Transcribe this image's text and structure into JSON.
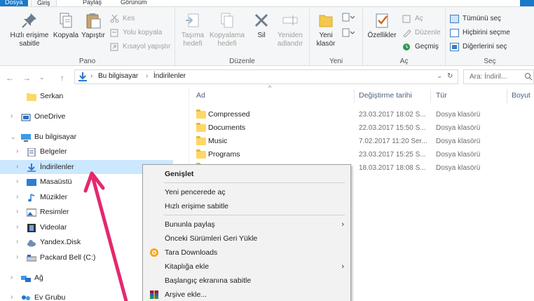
{
  "tabs": {
    "file": "Dosya",
    "home": "Giriş",
    "share": "Paylaş",
    "view": "Görünüm"
  },
  "ribbon": {
    "pano": {
      "label": "Pano",
      "pin": "Hızlı erişime sabitle",
      "copy": "Kopyala",
      "paste": "Yapıştır",
      "cut": "Kes",
      "copy_path": "Yolu kopyala",
      "paste_shortcut": "Kısayol yapıştır"
    },
    "duzenle": {
      "label": "Düzenle",
      "move_to": "Taşıma hedefi",
      "copy_to": "Kopyalama hedefi",
      "delete": "Sil",
      "rename": "Yeniden adlandır"
    },
    "yeni": {
      "label": "Yeni",
      "new_folder": "Yeni klasör"
    },
    "ac": {
      "label": "Aç",
      "properties": "Özellikler",
      "open": "Aç",
      "edit": "Düzenle",
      "history": "Geçmiş"
    },
    "sec": {
      "label": "Seç",
      "select_all": "Tümünü seç",
      "select_none": "Hiçbirini seçme",
      "invert": "Diğerlerini seç"
    }
  },
  "address": {
    "crumb1": "Bu bilgisayar",
    "crumb2": "İndirilenler",
    "search_placeholder": "Ara: İndiril..."
  },
  "nav": [
    {
      "label": "Serkan"
    },
    {
      "label": "OneDrive"
    },
    {
      "label": "Bu bilgisayar"
    },
    {
      "label": "Belgeler"
    },
    {
      "label": "İndirilenler"
    },
    {
      "label": "Masaüstü"
    },
    {
      "label": "Müzikler"
    },
    {
      "label": "Resimler"
    },
    {
      "label": "Videolar"
    },
    {
      "label": "Yandex.Disk"
    },
    {
      "label": "Packard Bell (C:)"
    },
    {
      "label": "Ağ"
    },
    {
      "label": "Ev Grubu"
    }
  ],
  "columns": {
    "name": "Ad",
    "date": "Değiştirme tarihi",
    "type": "Tür",
    "size": "Boyut"
  },
  "files": [
    {
      "name": "Compressed",
      "date": "23.03.2017 18:02 S...",
      "type": "Dosya klasörü"
    },
    {
      "name": "Documents",
      "date": "22.03.2017 15:50 S...",
      "type": "Dosya klasörü"
    },
    {
      "name": "Music",
      "date": "7.02.2017 11:20 Ser...",
      "type": "Dosya klasörü"
    },
    {
      "name": "Programs",
      "date": "23.03.2017 15:25 S...",
      "type": "Dosya klasörü"
    },
    {
      "name": "",
      "date": "18.03.2017 18:08 S...",
      "type": "Dosya klasörü"
    }
  ],
  "context_menu": [
    {
      "label": "Genişlet"
    },
    {
      "label": "Yeni pencerede aç"
    },
    {
      "label": "Hızlı erişime sabitle"
    },
    {
      "label": "Bununla paylaş"
    },
    {
      "label": "Önceki Sürümleri Geri Yükle"
    },
    {
      "label": "Tara Downloads"
    },
    {
      "label": "Kitaplığa ekle"
    },
    {
      "label": "Başlangıç ekranına sabitle"
    },
    {
      "label": "Arşive ekle..."
    }
  ],
  "colors": {
    "accent": "#1979ca",
    "selection": "#cce8ff",
    "annotation": "#e5286e"
  }
}
